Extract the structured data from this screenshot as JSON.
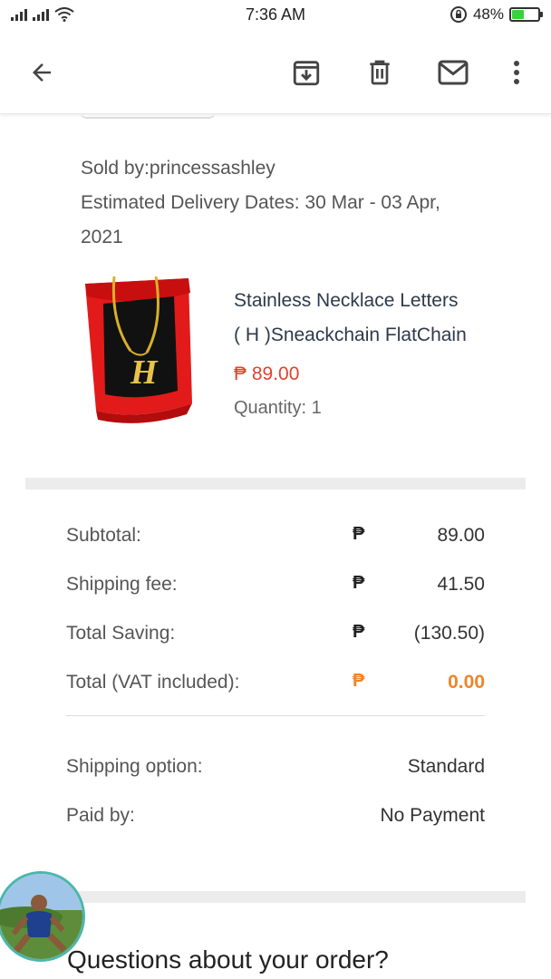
{
  "status_bar": {
    "time": "7:36 AM",
    "battery": "48%",
    "battery_level": 0.48
  },
  "app_bar": {
    "back_icon": "arrow-left-icon",
    "archive_icon": "archive-icon",
    "delete_icon": "trash-icon",
    "mail_icon": "mail-icon",
    "more_icon": "more-vert-icon"
  },
  "order": {
    "sold_by": "Sold by:princessashley",
    "delivery_line1": "Estimated Delivery Dates: 30 Mar - 03 Apr,",
    "delivery_line2": "2021",
    "product": {
      "name_line1": "Stainless Necklace Letters",
      "name_line2": "( H )Sneackchain FlatChain",
      "price": "₱ 89.00",
      "quantity": "Quantity: 1"
    }
  },
  "summary": {
    "currency": "₱",
    "rows": [
      {
        "label": "Subtotal:",
        "amount": "89.00"
      },
      {
        "label": "Shipping fee:",
        "amount": "41.50"
      },
      {
        "label": "Total Saving:",
        "amount": "(130.50)"
      },
      {
        "label": "Total (VAT included):",
        "amount": "0.00"
      }
    ]
  },
  "options": {
    "shipping_label": "Shipping option:",
    "shipping_value": "Standard",
    "paid_label": "Paid by:",
    "paid_value": "No Payment"
  },
  "questions_title": "Questions about your order?",
  "colors": {
    "price": "#e2422d",
    "total": "#f08428",
    "band": "#ececec"
  }
}
